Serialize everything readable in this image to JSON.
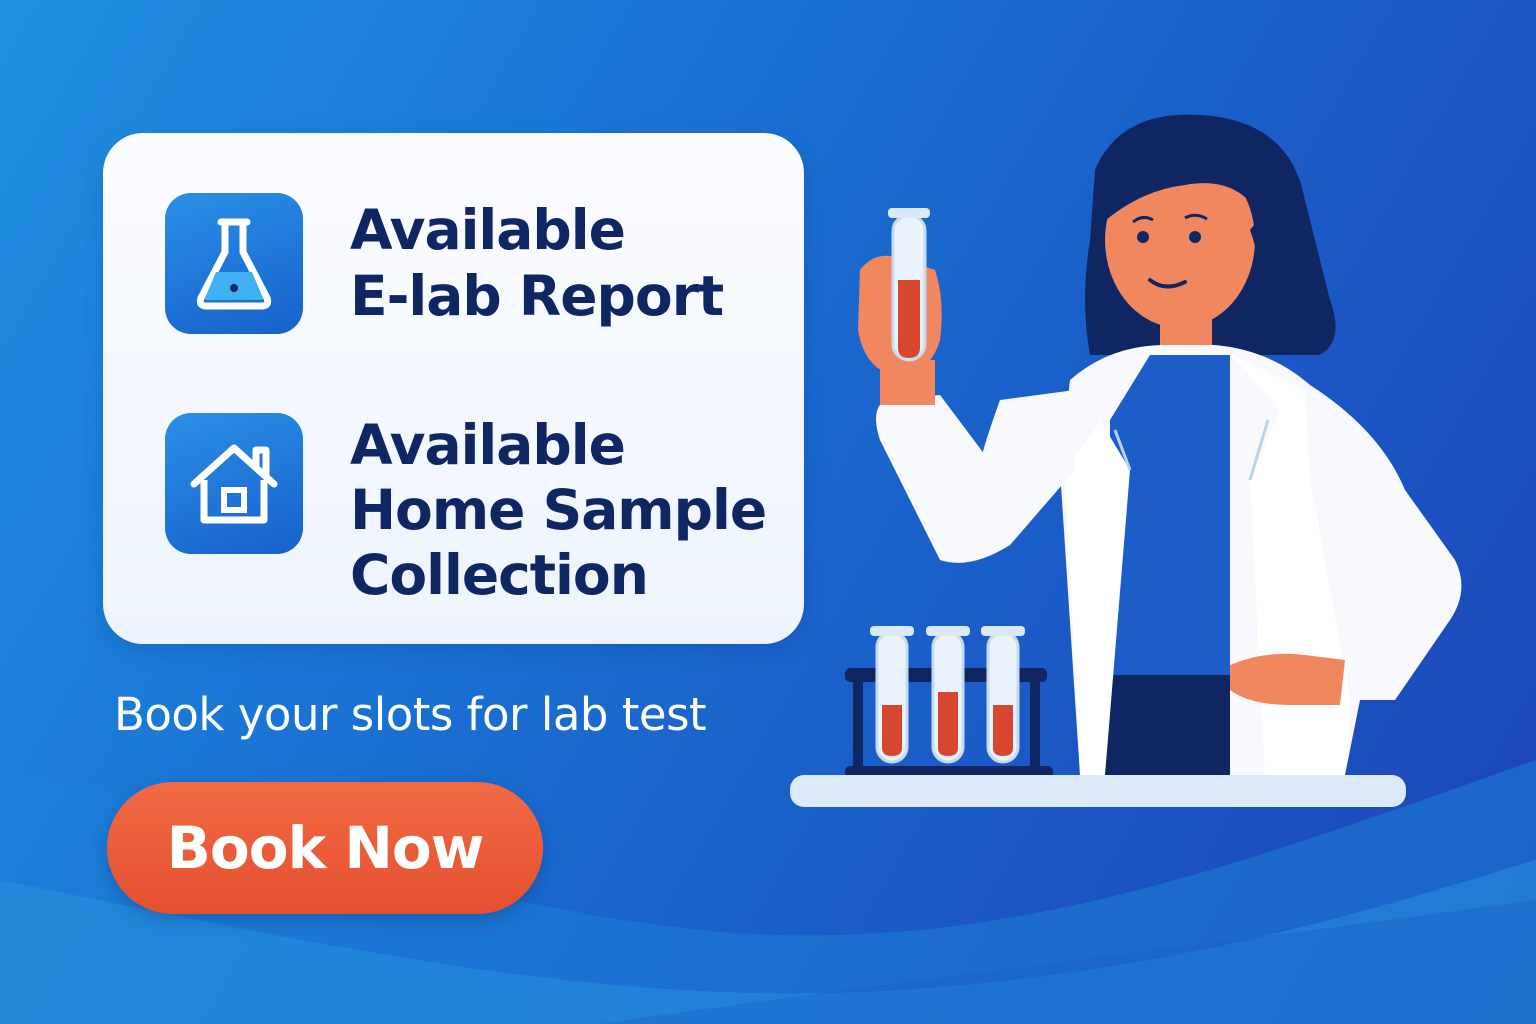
{
  "colors": {
    "background_start": "#1f8fe0",
    "background_end": "#1c43b6",
    "card": "#f4f8fe",
    "heading_text": "#0f2663",
    "accent": "#e85a36"
  },
  "features": [
    {
      "icon": "flask-icon",
      "lines": [
        "Available",
        "E-lab Report"
      ]
    },
    {
      "icon": "house-icon",
      "lines": [
        "Available",
        "Home Sample",
        "Collection"
      ]
    }
  ],
  "tagline": "Book your slots for lab test",
  "cta": {
    "label": "Book Now"
  },
  "illustration": {
    "subject": "scientist-illustration"
  }
}
